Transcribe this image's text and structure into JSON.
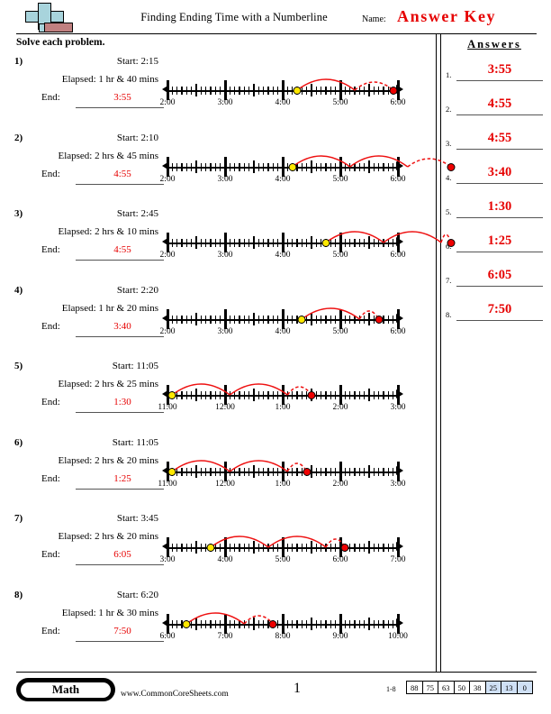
{
  "header": {
    "title": "Finding Ending Time with a Numberline",
    "name_label": "Name:",
    "answer_key": "Answer Key",
    "instruction": "Solve each problem.",
    "logo_icon": "plus-block-logo"
  },
  "answers_panel": {
    "heading": "Answers",
    "items": [
      {
        "num": "1.",
        "value": "3:55"
      },
      {
        "num": "2.",
        "value": "4:55"
      },
      {
        "num": "3.",
        "value": "4:55"
      },
      {
        "num": "4.",
        "value": "3:40"
      },
      {
        "num": "5.",
        "value": "1:30"
      },
      {
        "num": "6.",
        "value": "1:25"
      },
      {
        "num": "7.",
        "value": "6:05"
      },
      {
        "num": "8.",
        "value": "7:50"
      }
    ]
  },
  "labels": {
    "start": "Start:",
    "elapsed": "Elapsed:",
    "end": "End:"
  },
  "problems": [
    {
      "num": "1)",
      "start": "Start: 2:15",
      "elapsed": "Elapsed: 1 hr & 40 mins",
      "end_label": "End:",
      "end": "3:55",
      "start_time": 2.25,
      "end_time": 3.9167,
      "hours_whole": 1,
      "axis_start": 2,
      "axis_end": 6,
      "hour_labels": [
        "2:00",
        "3:00",
        "4:00",
        "5:00",
        "6:00"
      ]
    },
    {
      "num": "2)",
      "start": "Start: 2:10",
      "elapsed": "Elapsed: 2 hrs & 45 mins",
      "end_label": "End:",
      "end": "4:55",
      "start_time": 2.1667,
      "end_time": 4.9167,
      "hours_whole": 2,
      "axis_start": 2,
      "axis_end": 6,
      "hour_labels": [
        "2:00",
        "3:00",
        "4:00",
        "5:00",
        "6:00"
      ]
    },
    {
      "num": "3)",
      "start": "Start: 2:45",
      "elapsed": "Elapsed: 2 hrs & 10 mins",
      "end_label": "End:",
      "end": "4:55",
      "start_time": 2.75,
      "end_time": 4.9167,
      "hours_whole": 2,
      "axis_start": 2,
      "axis_end": 6,
      "hour_labels": [
        "2:00",
        "3:00",
        "4:00",
        "5:00",
        "6:00"
      ]
    },
    {
      "num": "4)",
      "start": "Start: 2:20",
      "elapsed": "Elapsed: 1 hr & 20 mins",
      "end_label": "End:",
      "end": "3:40",
      "start_time": 2.3333,
      "end_time": 3.6667,
      "hours_whole": 1,
      "axis_start": 2,
      "axis_end": 6,
      "hour_labels": [
        "2:00",
        "3:00",
        "4:00",
        "5:00",
        "6:00"
      ]
    },
    {
      "num": "5)",
      "start": "Start: 11:05",
      "elapsed": "Elapsed: 2 hrs & 25 mins",
      "end_label": "End:",
      "end": "1:30",
      "start_time": 0.0833,
      "end_time": 2.5,
      "hours_whole": 2,
      "axis_start": 0,
      "axis_end": 4,
      "hour_labels": [
        "11:00",
        "12:00",
        "1:00",
        "2:00",
        "3:00"
      ]
    },
    {
      "num": "6)",
      "start": "Start: 11:05",
      "elapsed": "Elapsed: 2 hrs & 20 mins",
      "end_label": "End:",
      "end": "1:25",
      "start_time": 0.0833,
      "end_time": 2.4167,
      "hours_whole": 2,
      "axis_start": 0,
      "axis_end": 4,
      "hour_labels": [
        "11:00",
        "12:00",
        "1:00",
        "2:00",
        "3:00"
      ]
    },
    {
      "num": "7)",
      "start": "Start: 3:45",
      "elapsed": "Elapsed: 2 hrs & 20 mins",
      "end_label": "End:",
      "end": "6:05",
      "start_time": 0.75,
      "end_time": 3.0833,
      "hours_whole": 2,
      "axis_start": 0,
      "axis_end": 4,
      "hour_labels": [
        "3:00",
        "4:00",
        "5:00",
        "6:00",
        "7:00"
      ]
    },
    {
      "num": "8)",
      "start": "Start: 6:20",
      "elapsed": "Elapsed: 1 hr & 30 mins",
      "end_label": "End:",
      "end": "7:50",
      "start_time": 0.3333,
      "end_time": 1.8333,
      "hours_whole": 1,
      "axis_start": 0,
      "axis_end": 4,
      "hour_labels": [
        "6:00",
        "7:00",
        "8:00",
        "9:00",
        "10:00"
      ]
    }
  ],
  "footer": {
    "subject": "Math",
    "website": "www.CommonCoreSheets.com",
    "page_number": "1",
    "score_range": "1-8",
    "score_values": [
      "88",
      "75",
      "63",
      "50",
      "38",
      "25",
      "13",
      "0"
    ],
    "highlight_from_index": 5,
    "highlight_color": "#cfe0f5"
  },
  "colors": {
    "answer_red": "#e60000",
    "start_dot": "#ffe800",
    "end_dot": "#ee0000",
    "logo_blue": "#a8d4dc",
    "logo_red": "#c08080"
  }
}
